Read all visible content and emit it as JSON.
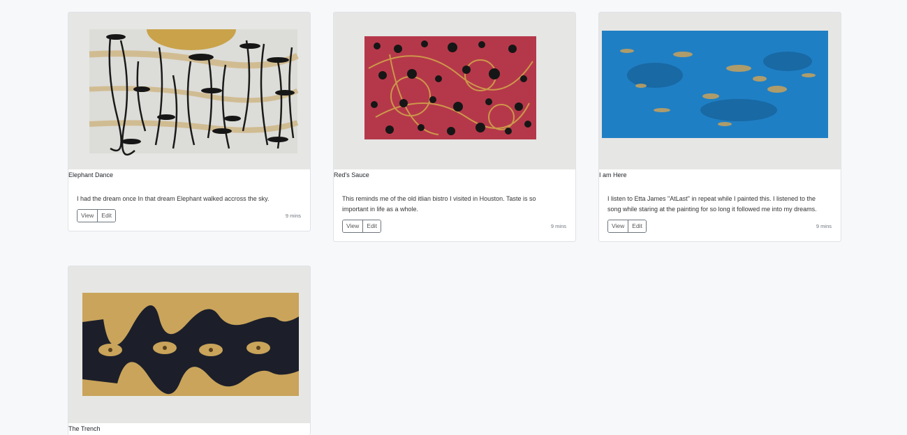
{
  "cards": [
    {
      "title": "Elephant Dance",
      "description": "I had the dream once In that dream Elephant walked accross the sky.",
      "view_label": "View",
      "edit_label": "Edit",
      "time": "9 mins",
      "image_colors": {
        "canvas": "#d9d9d6",
        "accent": "#c9a24a",
        "ink": "#1a1a1a"
      }
    },
    {
      "title": "Red's Sauce",
      "description": "This reminds me of the old itlian bistro I visited in Houston. Taste is so important in life as a whole.",
      "view_label": "View",
      "edit_label": "Edit",
      "time": "9 mins",
      "image_colors": {
        "canvas": "#b5384a",
        "accent": "#d2a94b",
        "ink": "#161616"
      }
    },
    {
      "title": "I am Here",
      "description": "I listen to Etta James \"AtLast\" in repeat while I painted this. I listened to the song while staring at the painting for so long it followed me into my dreams.",
      "view_label": "View",
      "edit_label": "Edit",
      "time": "9 mins",
      "image_colors": {
        "canvas": "#1f7fc4",
        "accent": "#c8a25c",
        "ink": "#145a90"
      }
    },
    {
      "title": "The Trench",
      "image_colors": {
        "canvas": "#1c1f2a",
        "accent": "#c9a45a",
        "ink": "#0f1118"
      }
    }
  ]
}
